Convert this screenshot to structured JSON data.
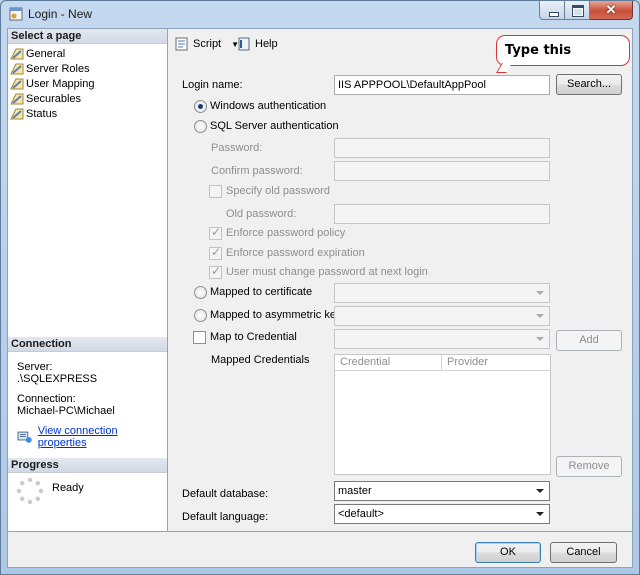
{
  "window": {
    "title": "Login - New"
  },
  "sidebar": {
    "select_header": "Select a page",
    "pages": [
      {
        "label": "General",
        "icon": "page-icon"
      },
      {
        "label": "Server Roles",
        "icon": "page-icon"
      },
      {
        "label": "User Mapping",
        "icon": "page-icon"
      },
      {
        "label": "Securables",
        "icon": "page-icon"
      },
      {
        "label": "Status",
        "icon": "page-icon"
      }
    ],
    "connection_header": "Connection",
    "server_label": "Server:",
    "server_value": ".\\SQLEXPRESS",
    "connection_label": "Connection:",
    "connection_value": "Michael-PC\\Michael",
    "view_link": "View connection properties",
    "progress_header": "Progress",
    "progress_status": "Ready"
  },
  "toolbar": {
    "script": "Script",
    "help": "Help"
  },
  "annotation": {
    "text": "Type this"
  },
  "form": {
    "login_name_label": "Login name:",
    "login_name_value": "IIS APPPOOL\\DefaultAppPool",
    "search_button": "Search...",
    "windows_auth": "Windows authentication",
    "sql_auth": "SQL Server authentication",
    "password_label": "Password:",
    "confirm_password_label": "Confirm password:",
    "specify_old_password": "Specify old password",
    "old_password_label": "Old password:",
    "enforce_policy": "Enforce password policy",
    "enforce_expiration": "Enforce password expiration",
    "must_change": "User must change password at next login",
    "mapped_cert": "Mapped to certificate",
    "mapped_asym": "Mapped to asymmetric key",
    "map_credential": "Map to Credential",
    "add_button": "Add",
    "mapped_credentials_label": "Mapped Credentials",
    "grid_columns": [
      "Credential",
      "Provider"
    ],
    "remove_button": "Remove",
    "default_db_label": "Default database:",
    "default_db_value": "master",
    "default_lang_label": "Default language:",
    "default_lang_value": "<default>"
  },
  "footer": {
    "ok": "OK",
    "cancel": "Cancel"
  },
  "colors": {
    "link": "#0033cc",
    "annotation_border": "#dd3333",
    "titlebar": "#c4d9ef"
  }
}
